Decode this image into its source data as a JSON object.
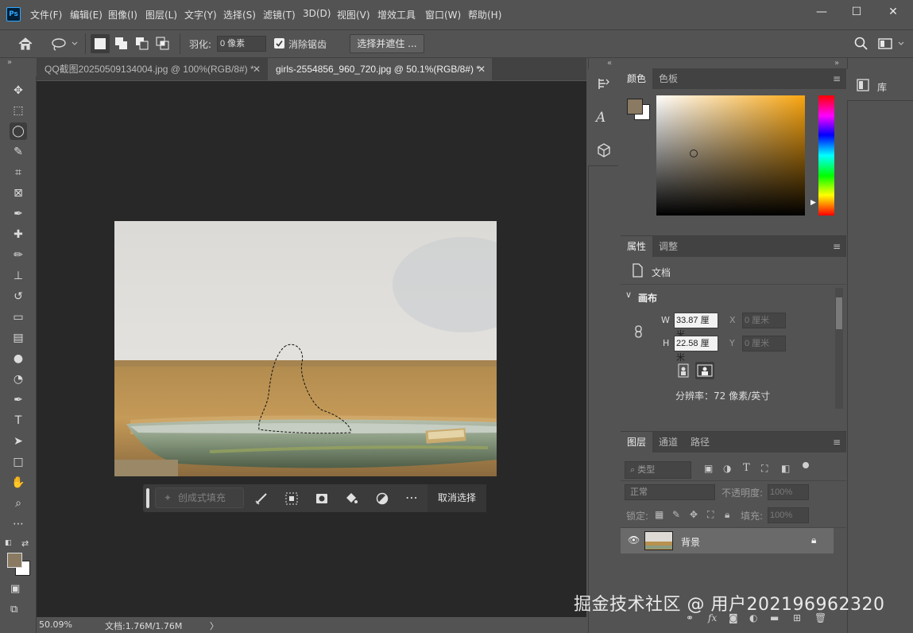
{
  "menu": {
    "logo": "Ps",
    "items": [
      "文件(F)",
      "编辑(E)",
      "图像(I)",
      "图层(L)",
      "文字(Y)",
      "选择(S)",
      "滤镜(T)",
      "3D(D)",
      "视图(V)",
      "增效工具",
      "窗口(W)",
      "帮助(H)"
    ],
    "window_controls": [
      "—",
      "☐",
      "✕"
    ]
  },
  "options": {
    "feather_label": "羽化:",
    "feather_value": "0 像素",
    "antialias_label": "消除锯齿",
    "antialias_checked": true,
    "select_mask_label": "选择并遮住 ..."
  },
  "tabs": [
    {
      "label": "QQ截图20250509134004.jpg @ 100%(RGB/8#) *",
      "active": false
    },
    {
      "label": "girls-2554856_960_720.jpg @ 50.1%(RGB/8#) *",
      "active": true
    }
  ],
  "tools": [
    "move-tool",
    "marquee-tool",
    "lasso-tool",
    "quick-select-tool",
    "crop-tool",
    "frame-tool",
    "eyedropper-tool",
    "healing-brush-tool",
    "brush-tool",
    "clone-stamp-tool",
    "history-brush-tool",
    "eraser-tool",
    "gradient-tool",
    "blur-tool",
    "dodge-tool",
    "pen-tool",
    "type-tool",
    "path-select-tool",
    "rectangle-tool",
    "hand-tool",
    "zoom-tool",
    "more-tools"
  ],
  "context_bar": {
    "gen_fill_label": "创成式填充",
    "deselect_label": "取消选择"
  },
  "status": {
    "zoom": "50.09%",
    "doc": "文档:1.76M/1.76M",
    "arrow": "〉"
  },
  "color_panel": {
    "tabs": [
      "颜色",
      "色板"
    ],
    "foreground": "#8a7a62",
    "background": "#ffffff",
    "hue_color": "#f9a50f"
  },
  "properties_panel": {
    "tabs": [
      "属性",
      "调整"
    ],
    "doc_label": "文档",
    "canvas_label": "画布",
    "w_label": "W",
    "w_value": "33.87 厘米",
    "h_label": "H",
    "h_value": "22.58 厘米",
    "x_label": "X",
    "x_value": "0 厘米",
    "y_label": "Y",
    "y_value": "0 厘米",
    "resolution": "分辨率：72 像素/英寸"
  },
  "layers_panel": {
    "tabs": [
      "图层",
      "通道",
      "路径"
    ],
    "filter_placeholder": "类型",
    "blend_mode": "正常",
    "opacity_label": "不透明度:",
    "opacity_value": "100%",
    "lock_label": "锁定:",
    "fill_label": "填充:",
    "fill_value": "100%",
    "layer_name": "背景"
  },
  "library": {
    "label": "库"
  },
  "watermark": "掘金技术社区 @ 用户202196962320"
}
